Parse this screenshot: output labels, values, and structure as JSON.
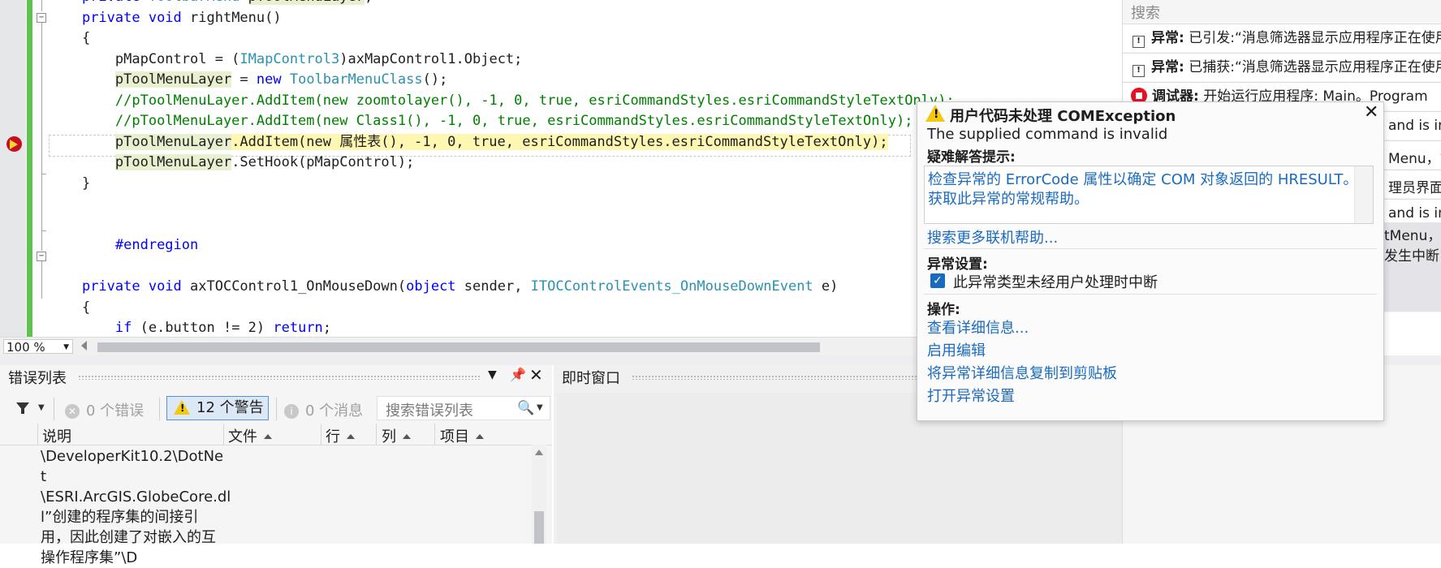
{
  "editor": {
    "lines": [
      [
        {
          "t": "    "
        },
        {
          "t": "private ",
          "c": "kw"
        },
        {
          "t": "ToolbarMenu ",
          "c": "ty"
        },
        {
          "t": "pToolMenuLayer",
          "c": "hl-ref"
        },
        {
          "t": ";"
        }
      ],
      [
        {
          "t": "    "
        },
        {
          "t": "private void ",
          "c": "kw"
        },
        {
          "t": "rightMenu()"
        }
      ],
      [
        {
          "t": "    {"
        }
      ],
      [
        {
          "t": "        pMapControl = ("
        },
        {
          "t": "IMapControl3",
          "c": "ty"
        },
        {
          "t": ")axMapControl1.Object;"
        }
      ],
      [
        {
          "t": "        "
        },
        {
          "t": "pToolMenuLayer",
          "c": "hl-ref"
        },
        {
          "t": " = "
        },
        {
          "t": "new ",
          "c": "kw"
        },
        {
          "t": "ToolbarMenuClass",
          "c": "ty"
        },
        {
          "t": "();"
        }
      ],
      [
        {
          "t": "        "
        },
        {
          "t": "//pToolMenuLayer.AddItem(new zoomtolayer(), -1, 0, true, esriCommandStyles.esriCommandStyleTextOnly);",
          "c": "cm"
        }
      ],
      [
        {
          "t": "        "
        },
        {
          "t": "//pToolMenuLayer.AddItem(new Class1(), -1, 0, true, esriCommandStyles.esriCommandStyleTextOnly);",
          "c": "cm"
        }
      ],
      [
        {
          "t": "        "
        },
        {
          "t": "pToolMenuLayer",
          "c": "hl-ref"
        },
        {
          "t": ".AddItem(new 属性表(), -1, 0, true, esriCommandStyles.esriCommandStyleTextOnly);",
          "c": "hl-exec"
        }
      ],
      [
        {
          "t": "        "
        },
        {
          "t": "pToolMenuLayer",
          "c": "hl-ref"
        },
        {
          "t": ".SetHook(pMapControl);"
        }
      ],
      [
        {
          "t": "    }"
        }
      ],
      [
        {
          "t": ""
        }
      ],
      [
        {
          "t": ""
        }
      ],
      [
        {
          "t": "        "
        },
        {
          "t": "#endregion",
          "c": "kw"
        }
      ],
      [
        {
          "t": ""
        }
      ],
      [
        {
          "t": "    "
        },
        {
          "t": "private void ",
          "c": "kw"
        },
        {
          "t": "axTOCControl1_OnMouseDown("
        },
        {
          "t": "object ",
          "c": "kw"
        },
        {
          "t": "sender, "
        },
        {
          "t": "ITOCControlEvents_OnMouseDownEvent ",
          "c": "ty"
        },
        {
          "t": "e)"
        }
      ],
      [
        {
          "t": "    {"
        }
      ],
      [
        {
          "t": "        "
        },
        {
          "t": "if ",
          "c": "kw"
        },
        {
          "t": "(e.button != 2) "
        },
        {
          "t": "return",
          "c": "kw"
        },
        {
          "t": ";"
        }
      ]
    ],
    "zoom": "100 %"
  },
  "output": {
    "search_placeholder": "搜索",
    "rows": [
      {
        "label": "异常:",
        "text": "已引发:“消息筛选器显示应用程序正在使用中。”"
      },
      {
        "label": "异常:",
        "text": "已捕获:“消息筛选器显示应用程序正在使用中。”"
      },
      {
        "label": "调试器:",
        "text": "开始运行应用程序: Main。Program"
      }
    ],
    "fragments": [
      "and is in",
      "Menu，管",
      "理员界面",
      "and is in"
    ],
    "gray_a": "tMenu，管",
    "gray_b": "发生中断"
  },
  "error_list": {
    "title": "错误列表",
    "errors_label": "0 个错误",
    "warnings_label": "12 个警告",
    "messages_label": "0 个消息",
    "search_placeholder": "搜索错误列表",
    "columns": [
      "说明",
      "文件",
      "行",
      "列",
      "项目"
    ],
    "body_lines": [
      "\\DeveloperKit10.2\\DotNe",
      "t",
      "\\ESRI.ArcGIS.GlobeCore.dl",
      "l”创建的程序集的间接引",
      "用，因此创建了对嵌入的互",
      "操作程序集”\\D"
    ]
  },
  "immediate": {
    "title": "即时窗口"
  },
  "exception": {
    "title": "用户代码未处理 COMException",
    "message": "The supplied command is invalid",
    "hint_header": "疑难解答提示:",
    "hint_1": "检查异常的 ErrorCode 属性以确定 COM 对象返回的 HRESULT。",
    "hint_2": "获取此异常的常规帮助。",
    "online_help": "搜索更多联机帮助...",
    "settings_header": "异常设置:",
    "break_label": "此异常类型未经用户处理时中断",
    "actions_header": "操作:",
    "actions": [
      "查看详细信息...",
      "启用编辑",
      "将异常详细信息复制到剪贴板",
      "打开异常设置"
    ]
  }
}
